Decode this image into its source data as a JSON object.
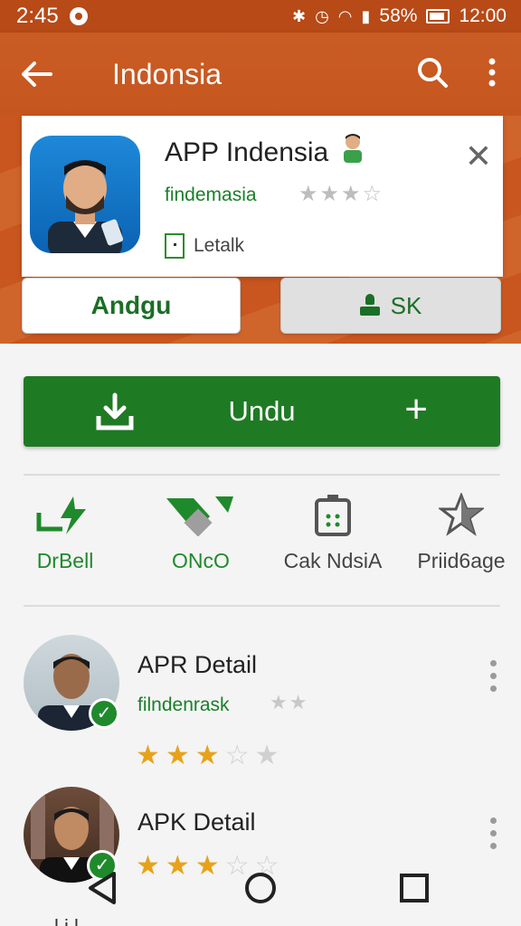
{
  "status": {
    "time_left": "2:45",
    "battery": "58%",
    "clock": "12:00"
  },
  "appbar": {
    "title": "Indonsia",
    "back_icon": "arrow-back-icon",
    "search_icon": "search-icon",
    "menu_icon": "more-vert-icon"
  },
  "app": {
    "name": "APP Indensia",
    "developer": "findemasia",
    "rating_stars": "★★★☆",
    "meta_label": "Letalk",
    "secondary_button": "Andgu",
    "account_button": "SK"
  },
  "install": {
    "label": "Undu"
  },
  "features": [
    {
      "label": "DrBell",
      "color": "#1f8a2c"
    },
    {
      "label": "ONcO",
      "color": "#1f8a2c"
    },
    {
      "label": "Cak NdsiA",
      "color": "#444444"
    },
    {
      "label": "Priid6age",
      "color": "#444444"
    }
  ],
  "items": [
    {
      "title": "APR Detail",
      "developer": "filndenrask",
      "stars": 3,
      "small_stars": "★★"
    },
    {
      "title": "APK Detail",
      "stars": 3
    }
  ],
  "peek_text": "l  i   l",
  "colors": {
    "brand": "#c6561f",
    "accent": "#1f7a24",
    "star": "#e7a21a"
  }
}
